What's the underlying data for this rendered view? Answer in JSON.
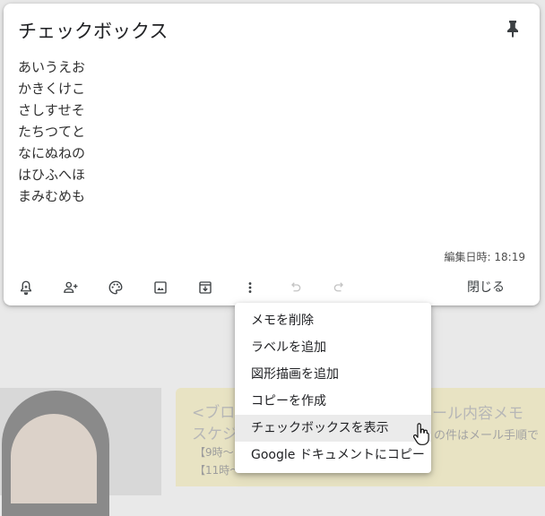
{
  "note": {
    "title": "チェックボックス",
    "lines": [
      "あいうえお",
      "かきくけこ",
      "さしすせそ",
      "たちつてと",
      "なにぬねの",
      "はひふへほ",
      "まみむめも"
    ],
    "edited": "編集日時: 18:19",
    "close_label": "閉じる"
  },
  "toolbar": {
    "icons": [
      "reminder-icon",
      "collaborator-icon",
      "palette-icon",
      "image-icon",
      "archive-icon",
      "more-icon",
      "undo-icon",
      "redo-icon"
    ]
  },
  "menu": {
    "items": [
      {
        "label": "メモを削除"
      },
      {
        "label": "ラベルを追加"
      },
      {
        "label": "図形描画を追加"
      },
      {
        "label": "コピーを作成"
      },
      {
        "label": "チェックボックスを表示"
      },
      {
        "label": "Google ドキュメントにコピー"
      }
    ],
    "hovered_index": 4
  },
  "background": {
    "note_line1": "<ブロ",
    "note_line2": "スケジ",
    "note_line3": "【9時〜",
    "note_line4": "【11時〜",
    "right_title": "ール内容メモ",
    "right_sub": "の件はメール手順で"
  },
  "colors": {
    "accent_hover": "#ebebeb",
    "card": "#ffffff",
    "backdrop": "#e9e9e9"
  }
}
